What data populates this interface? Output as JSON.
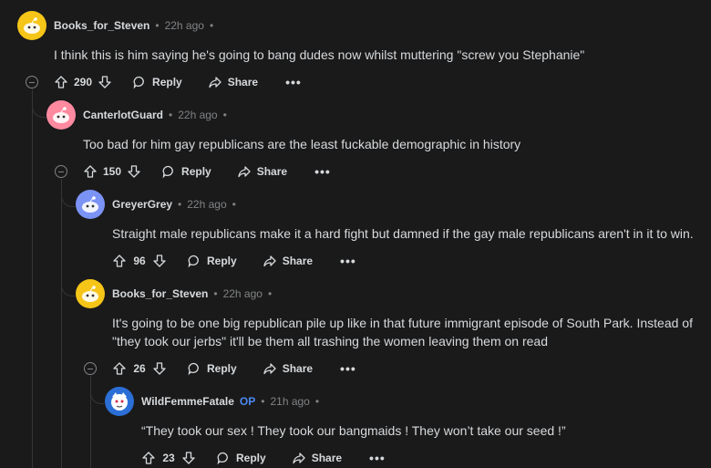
{
  "actions": {
    "reply": "Reply",
    "share": "Share",
    "more": "•••"
  },
  "comments": [
    {
      "username": "Books_for_Steven",
      "time": "22h ago",
      "text": "I think this is him saying he's going to bang dudes now whilst muttering \"screw you Stephanie\"",
      "votes": "290",
      "avatar_color": "#f5c518"
    },
    {
      "username": "CanterlotGuard",
      "time": "22h ago",
      "text": "Too bad for him gay republicans are the least fuckable demographic in history",
      "votes": "150",
      "avatar_color": "#ff8aa0"
    },
    {
      "username": "GreyerGrey",
      "time": "22h ago",
      "text": "Straight male republicans make it a hard fight but damned if the gay male republicans aren't in it to win.",
      "votes": "96",
      "avatar_color": "#7b93f5"
    },
    {
      "username": "Books_for_Steven",
      "time": "22h ago",
      "text": "It's going to be one big republican pile up like in that future immigrant episode of South Park. Instead of \"they took our jerbs\" it'll be them all trashing the women leaving them on read",
      "votes": "26",
      "avatar_color": "#f5c518"
    },
    {
      "username": "WildFemmeFatale",
      "op_badge": "OP",
      "time": "21h ago",
      "text": "“They took our sex ! They took our bangmaids ! They won’t take our seed !”",
      "votes": "23",
      "avatar_color": "#2b6fd6"
    }
  ]
}
